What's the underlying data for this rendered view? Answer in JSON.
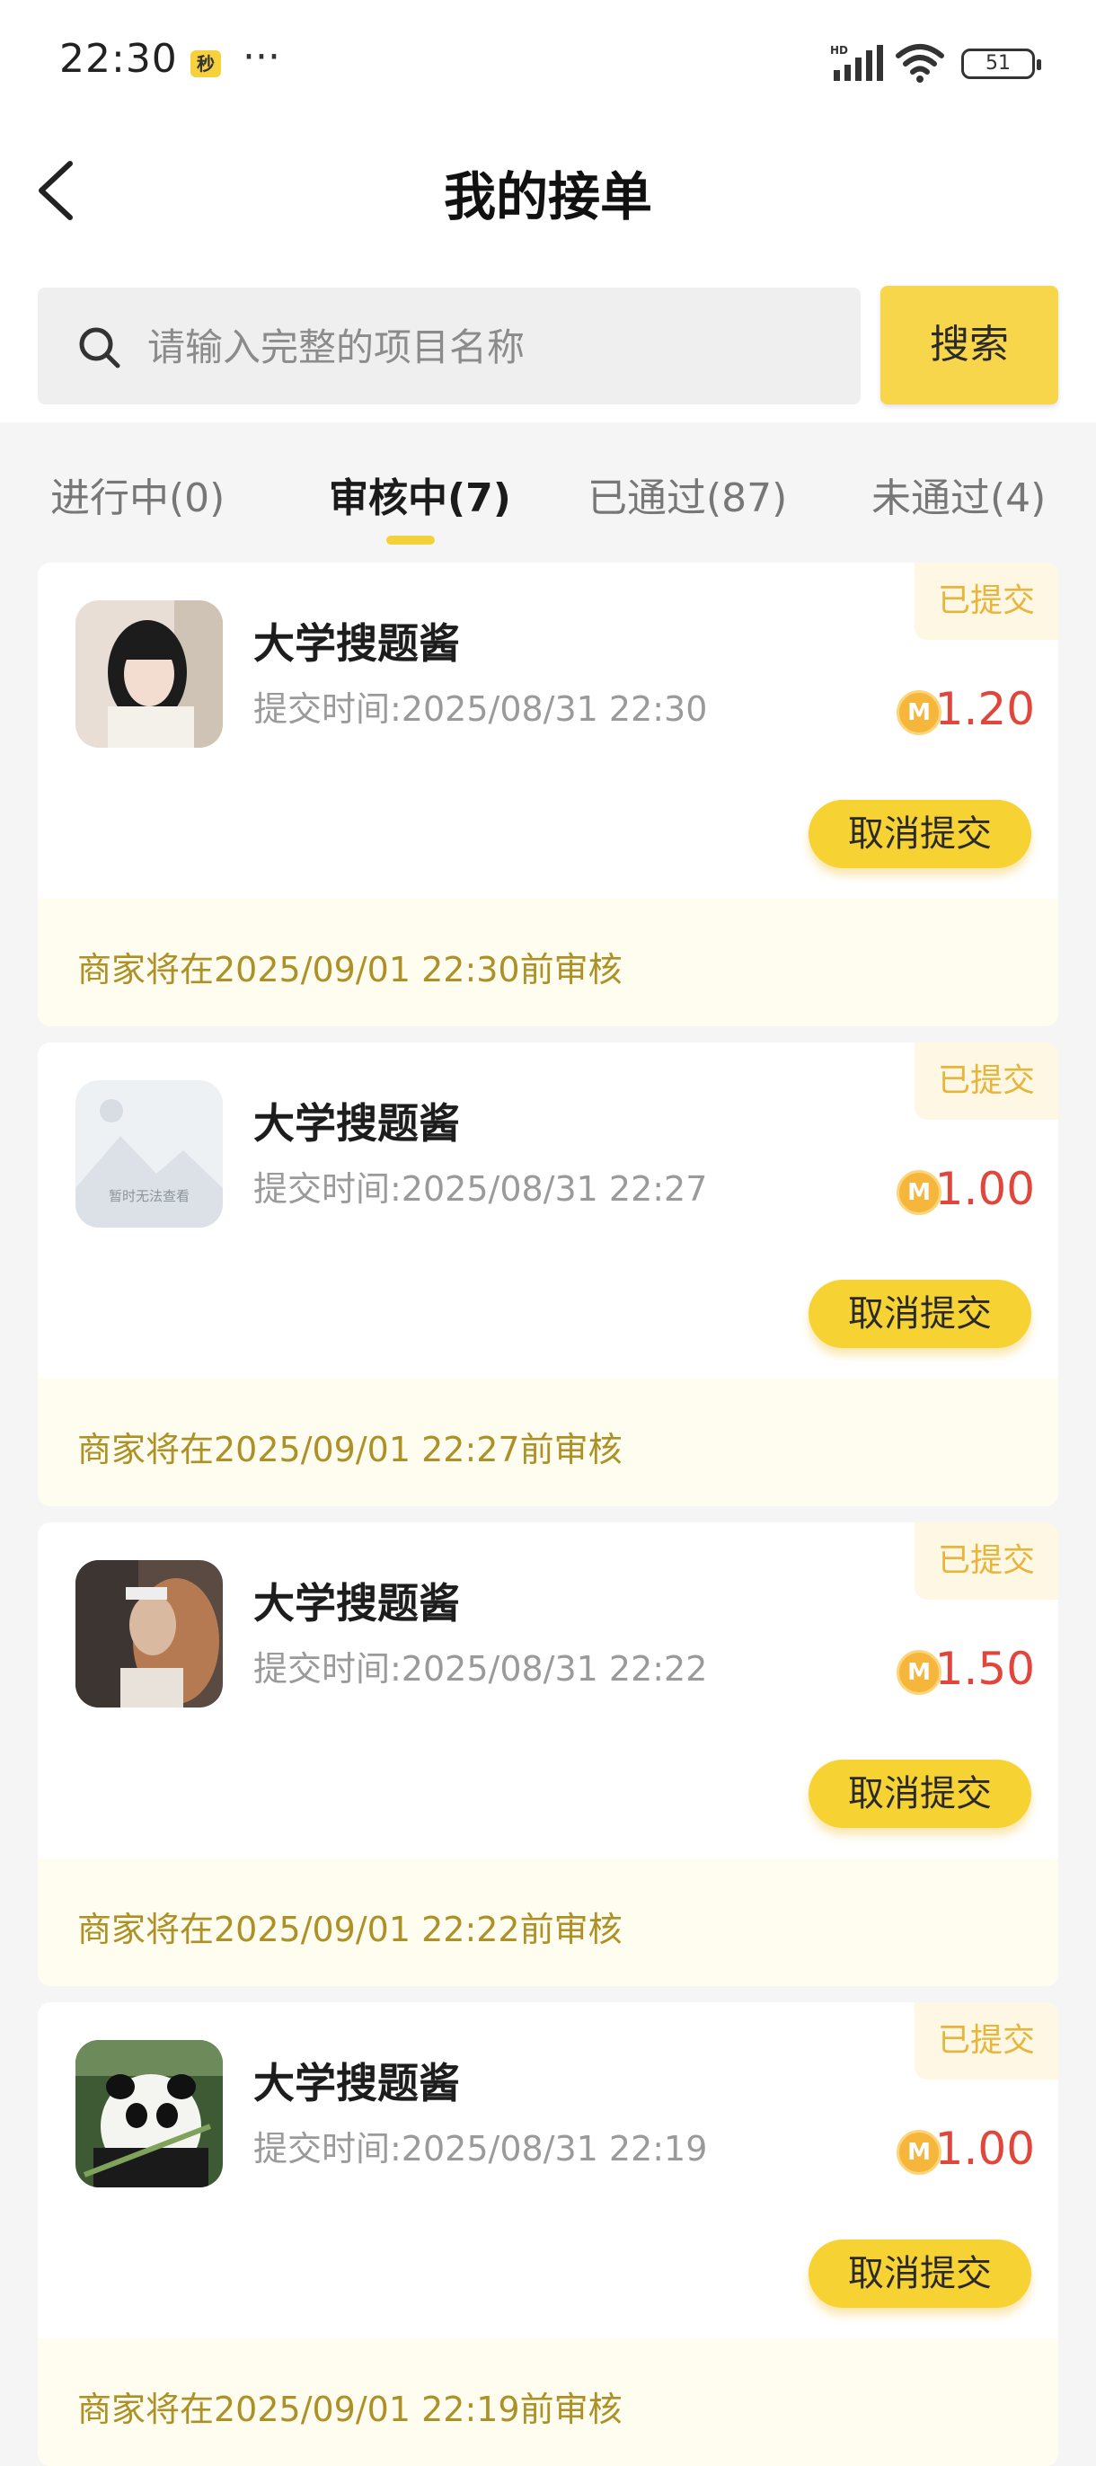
{
  "status_bar": {
    "time": "22:30",
    "app_badge": "秒",
    "more": "···",
    "battery": "51"
  },
  "header": {
    "title": "我的接单"
  },
  "search": {
    "placeholder": "请输入完整的项目名称",
    "button": "搜索"
  },
  "tabs": [
    {
      "label": "进行中(0)"
    },
    {
      "label": "审核中(7)"
    },
    {
      "label": "已通过(87)"
    },
    {
      "label": "未通过(4)"
    }
  ],
  "active_tab": "审核中(7)",
  "orders": [
    {
      "name": "大学搜题酱",
      "submit_time": "提交时间:2025/08/31 22:30",
      "status": "已提交",
      "price": "1.20",
      "coin": "M",
      "action": "取消提交",
      "note": "商家将在2025/09/01 22:30前审核"
    },
    {
      "name": "大学搜题酱",
      "submit_time": "提交时间:2025/08/31 22:27",
      "status": "已提交",
      "price": "1.00",
      "coin": "M",
      "action": "取消提交",
      "note": "商家将在2025/09/01 22:27前审核",
      "thumb_text": "暂时无法查看"
    },
    {
      "name": "大学搜题酱",
      "submit_time": "提交时间:2025/08/31 22:22",
      "status": "已提交",
      "price": "1.50",
      "coin": "M",
      "action": "取消提交",
      "note": "商家将在2025/09/01 22:22前审核"
    },
    {
      "name": "大学搜题酱",
      "submit_time": "提交时间:2025/08/31 22:19",
      "status": "已提交",
      "price": "1.00",
      "coin": "M",
      "action": "取消提交",
      "note": "商家将在2025/09/01 22:19前审核"
    }
  ],
  "colors": {
    "accent": "#f7d233",
    "price": "#e0463b",
    "note": "#ad9126",
    "tag": "#e7b53b"
  }
}
